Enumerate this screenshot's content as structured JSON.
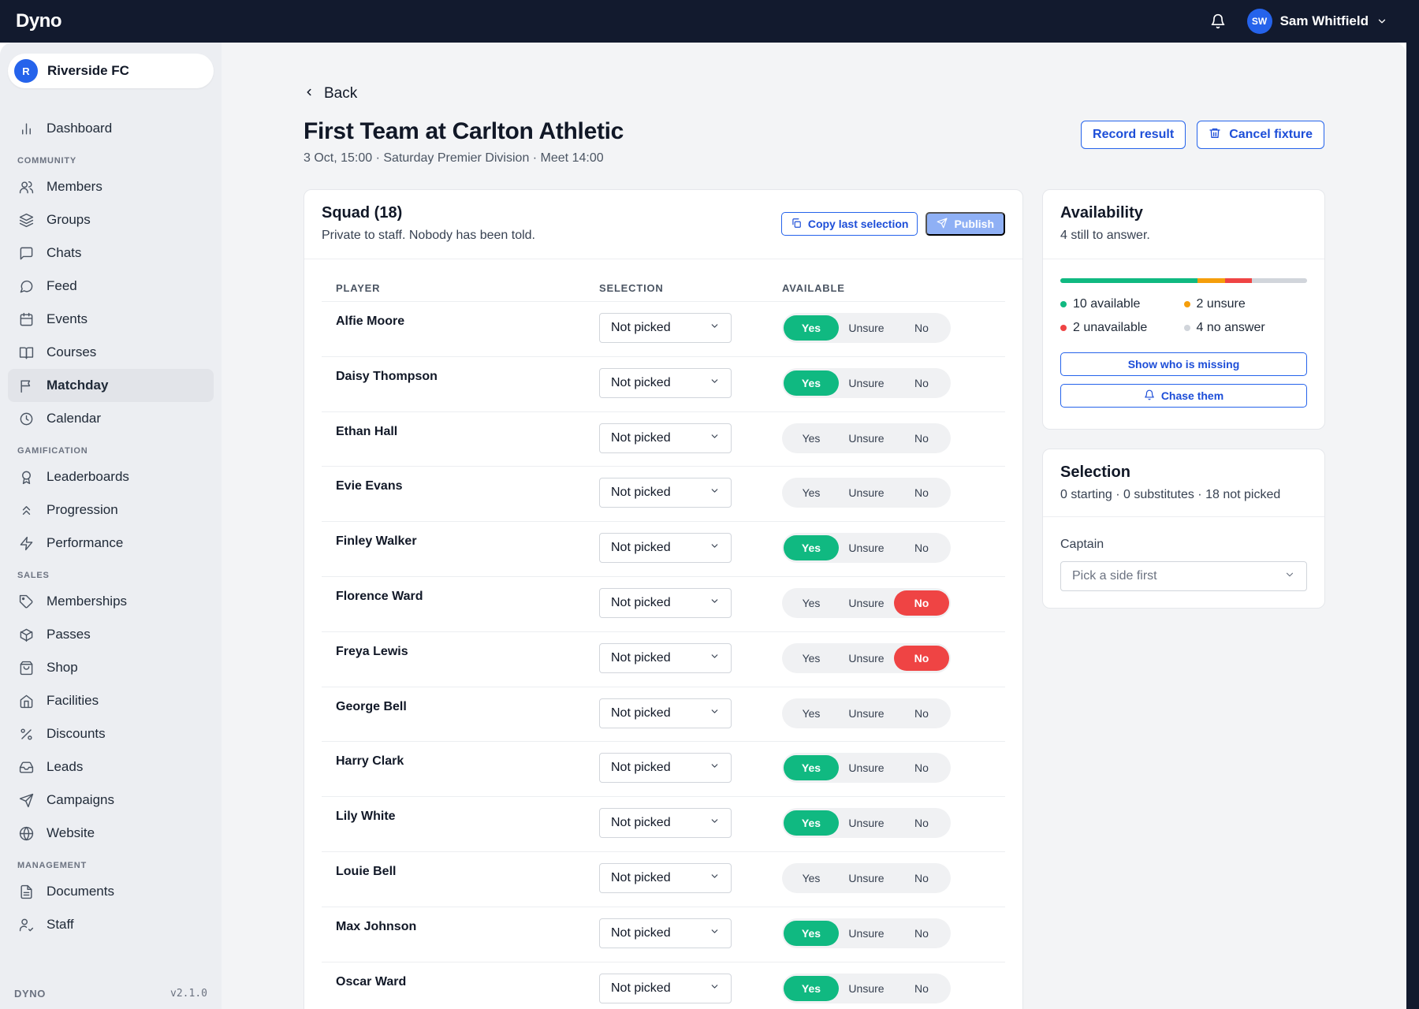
{
  "app": {
    "brand": "Dyno",
    "version": "v2.1.0",
    "footer_label": "DYNO"
  },
  "user": {
    "initials": "SW",
    "name": "Sam Whitfield"
  },
  "org": {
    "initial": "R",
    "name": "Riverside FC"
  },
  "nav": {
    "top": [
      {
        "label": "Dashboard",
        "icon": "bar-chart-icon"
      }
    ],
    "sections": [
      {
        "title": "COMMUNITY",
        "items": [
          {
            "label": "Members",
            "icon": "users-icon"
          },
          {
            "label": "Groups",
            "icon": "layers-icon"
          },
          {
            "label": "Chats",
            "icon": "chat-square-icon"
          },
          {
            "label": "Feed",
            "icon": "chat-bubble-icon"
          },
          {
            "label": "Events",
            "icon": "calendar-icon"
          },
          {
            "label": "Courses",
            "icon": "book-icon"
          },
          {
            "label": "Matchday",
            "icon": "flag-icon",
            "active": true
          },
          {
            "label": "Calendar",
            "icon": "clock-icon"
          }
        ]
      },
      {
        "title": "GAMIFICATION",
        "items": [
          {
            "label": "Leaderboards",
            "icon": "award-icon"
          },
          {
            "label": "Progression",
            "icon": "chevrons-up-icon"
          },
          {
            "label": "Performance",
            "icon": "bolt-icon"
          }
        ]
      },
      {
        "title": "SALES",
        "items": [
          {
            "label": "Memberships",
            "icon": "tag-icon"
          },
          {
            "label": "Passes",
            "icon": "box-icon"
          },
          {
            "label": "Shop",
            "icon": "shopping-bag-icon"
          },
          {
            "label": "Facilities",
            "icon": "home-icon"
          },
          {
            "label": "Discounts",
            "icon": "percent-icon"
          },
          {
            "label": "Leads",
            "icon": "inbox-icon"
          },
          {
            "label": "Campaigns",
            "icon": "send-icon"
          },
          {
            "label": "Website",
            "icon": "globe-icon"
          }
        ]
      },
      {
        "title": "MANAGEMENT",
        "items": [
          {
            "label": "Documents",
            "icon": "document-icon"
          },
          {
            "label": "Staff",
            "icon": "user-check-icon"
          }
        ]
      }
    ]
  },
  "page": {
    "back_label": "Back",
    "title": "First Team at Carlton Athletic",
    "subtitle": "3 Oct, 15:00 · Saturday Premier Division · Meet 14:00",
    "record_result": "Record result",
    "cancel_fixture": "Cancel fixture"
  },
  "squad": {
    "title": "Squad (18)",
    "subtitle": "Private to staff. Nobody has been told.",
    "copy_label": "Copy last selection",
    "publish_label": "Publish",
    "col_player": "PLAYER",
    "col_selection": "SELECTION",
    "col_available": "AVAILABLE",
    "options": {
      "yes": "Yes",
      "unsure": "Unsure",
      "no": "No"
    },
    "players": [
      {
        "name": "Alfie Moore",
        "selection": "Not picked",
        "available": "yes"
      },
      {
        "name": "Daisy Thompson",
        "selection": "Not picked",
        "available": "yes"
      },
      {
        "name": "Ethan Hall",
        "selection": "Not picked",
        "available": "none"
      },
      {
        "name": "Evie Evans",
        "selection": "Not picked",
        "available": "none"
      },
      {
        "name": "Finley Walker",
        "selection": "Not picked",
        "available": "yes"
      },
      {
        "name": "Florence Ward",
        "selection": "Not picked",
        "available": "no"
      },
      {
        "name": "Freya Lewis",
        "selection": "Not picked",
        "available": "no"
      },
      {
        "name": "George Bell",
        "selection": "Not picked",
        "available": "none"
      },
      {
        "name": "Harry Clark",
        "selection": "Not picked",
        "available": "yes"
      },
      {
        "name": "Lily White",
        "selection": "Not picked",
        "available": "yes"
      },
      {
        "name": "Louie Bell",
        "selection": "Not picked",
        "available": "none"
      },
      {
        "name": "Max Johnson",
        "selection": "Not picked",
        "available": "yes"
      },
      {
        "name": "Oscar Ward",
        "selection": "Not picked",
        "available": "yes"
      }
    ]
  },
  "availability": {
    "title": "Availability",
    "subtitle": "4 still to answer.",
    "counts": {
      "available": 10,
      "unsure": 2,
      "unavailable": 2,
      "no_answer": 4
    },
    "legend": {
      "available": "10 available",
      "unsure": "2 unsure",
      "unavailable": "2 unavailable",
      "no_answer": "4 no answer"
    },
    "colors": {
      "available": "#10b981",
      "unsure": "#f59e0b",
      "unavailable": "#ef4444",
      "no_answer": "#d1d5db"
    },
    "show_missing": "Show who is missing",
    "chase": "Chase them"
  },
  "selection": {
    "title": "Selection",
    "subtitle": "0 starting · 0 substitutes · 18 not picked",
    "captain_label": "Captain",
    "captain_placeholder": "Pick a side first"
  }
}
